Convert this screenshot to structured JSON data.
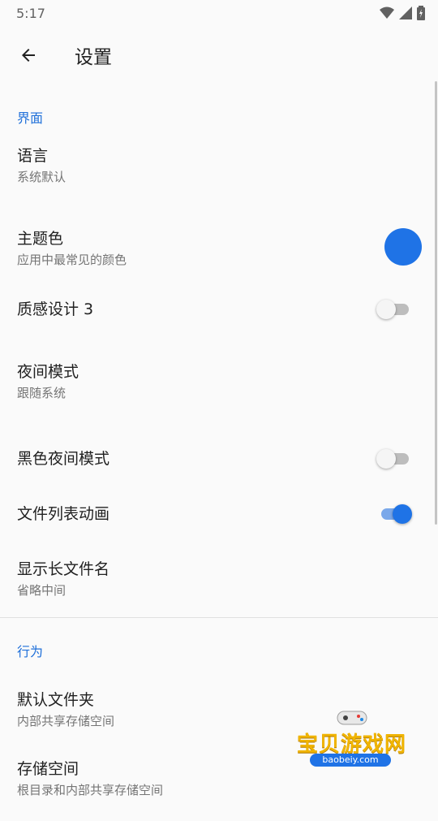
{
  "status_bar": {
    "time": "5:17"
  },
  "app_bar": {
    "title": "设置"
  },
  "sections": {
    "interface": {
      "header": "界面",
      "language": {
        "title": "语言",
        "summary": "系统默认"
      },
      "theme_color": {
        "title": "主题色",
        "summary": "应用中最常见的颜色",
        "color": "#1f73e6"
      },
      "material3": {
        "title": "质感设计 3",
        "enabled": false
      },
      "night_mode": {
        "title": "夜间模式",
        "summary": "跟随系统"
      },
      "black_night": {
        "title": "黑色夜间模式",
        "enabled": false
      },
      "file_list_anim": {
        "title": "文件列表动画",
        "enabled": true
      },
      "long_names": {
        "title": "显示长文件名",
        "summary": "省略中间"
      }
    },
    "behavior": {
      "header": "行为",
      "default_folder": {
        "title": "默认文件夹",
        "summary": "内部共享存储空间"
      },
      "storage": {
        "title": "存储空间",
        "summary": "根目录和内部共享存储空间"
      }
    }
  },
  "watermark": {
    "text": "宝贝游戏网",
    "url": "baobeiy.com"
  },
  "colors": {
    "accent": "#1f73e6",
    "section_header": "#1e6fd9"
  }
}
